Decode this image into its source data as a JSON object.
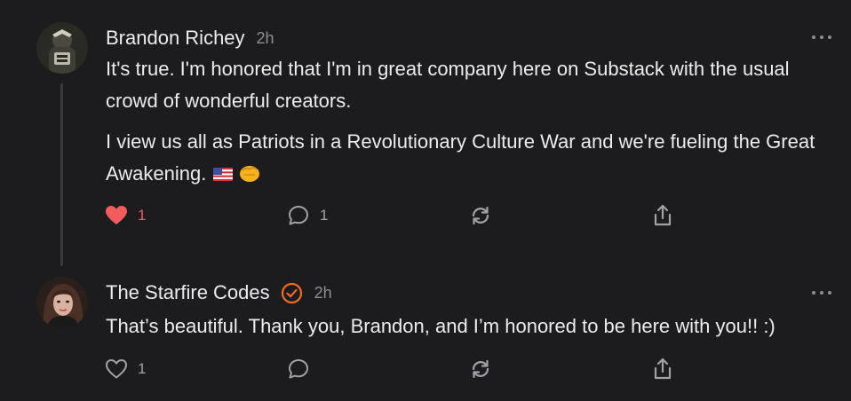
{
  "comments": [
    {
      "author": "Brandon Richey",
      "time": "2h",
      "verified": false,
      "paragraphs": [
        "It's true. I'm honored that I'm in great company here on Substack with the usual crowd of wonderful creators.",
        "I view us all as Patriots in a Revolutionary Culture War and we're fueling the Great Awakening."
      ],
      "emojis": [
        "🇺🇸",
        "👊"
      ],
      "likes": "1",
      "liked": true,
      "replies": "1"
    },
    {
      "author": "The Starfire Codes",
      "time": "2h",
      "verified": true,
      "paragraphs": [
        "That’s beautiful. Thank you, Brandon, and I’m honored to be here with you!! :)"
      ],
      "likes": "1",
      "liked": false,
      "replies": ""
    }
  ],
  "colors": {
    "background": "#1c1c1e",
    "text": "#ececec",
    "muted": "#8e8e93",
    "like_active": "#f25c5c",
    "verified_accent": "#f26b21"
  },
  "icons": [
    "heart-icon",
    "comment-icon",
    "restack-icon",
    "share-icon",
    "more-icon",
    "verified-check-icon"
  ]
}
